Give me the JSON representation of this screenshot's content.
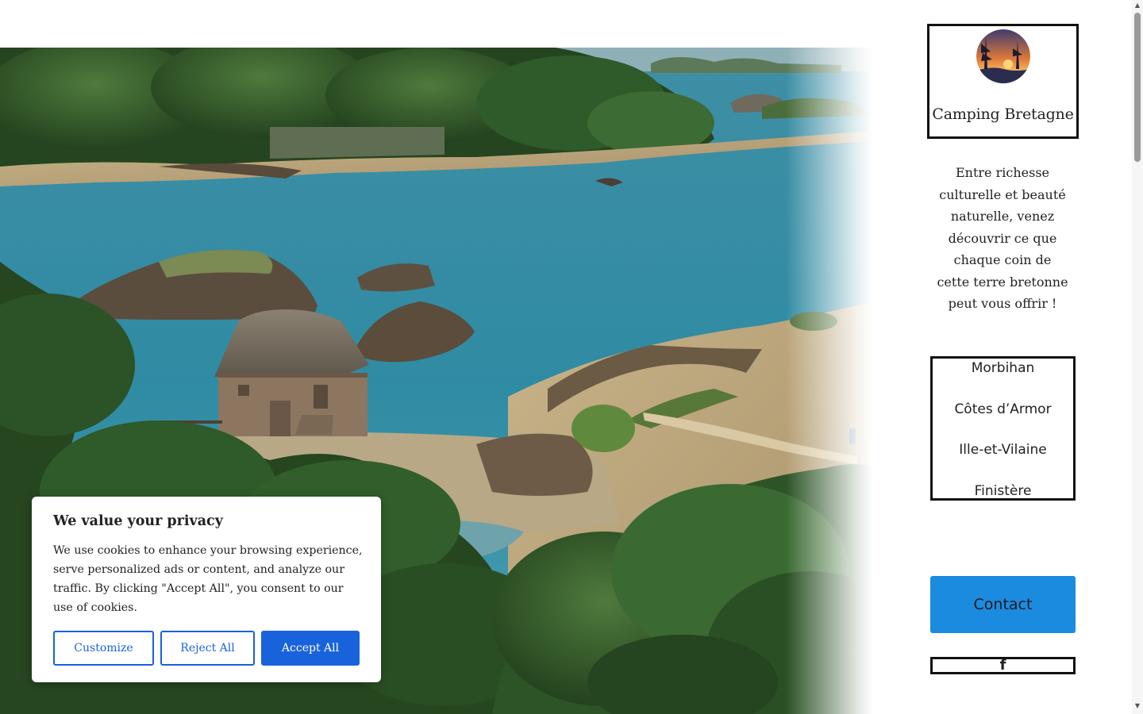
{
  "site": {
    "title": "Camping Bretagne",
    "tagline": "Entre richesse culturelle et beauté naturelle, venez découvrir ce que chaque coin de cette terre bretonne peut vous offrir !",
    "logo_icon": "sunset-forest-logo"
  },
  "regions_menu": {
    "items": [
      {
        "label": "Morbihan"
      },
      {
        "label": "Côtes d’Armor"
      },
      {
        "label": "Ille-et-Vilaine"
      },
      {
        "label": "Finistère"
      }
    ]
  },
  "contact": {
    "label": "Contact",
    "color": "#1b8be0"
  },
  "social": {
    "icon": "facebook-icon",
    "glyph": "f"
  },
  "hero": {
    "image_icon": "coastal-landscape-photo"
  },
  "cookie_banner": {
    "title": "We value your privacy",
    "text": "We use cookies to enhance your browsing experience, serve personalized ads or content, and analyze our traffic. By clicking \"Accept All\", you consent to our use of cookies.",
    "customize_label": "Customize",
    "reject_label": "Reject All",
    "accept_label": "Accept All",
    "accent_color": "#1863dc"
  }
}
